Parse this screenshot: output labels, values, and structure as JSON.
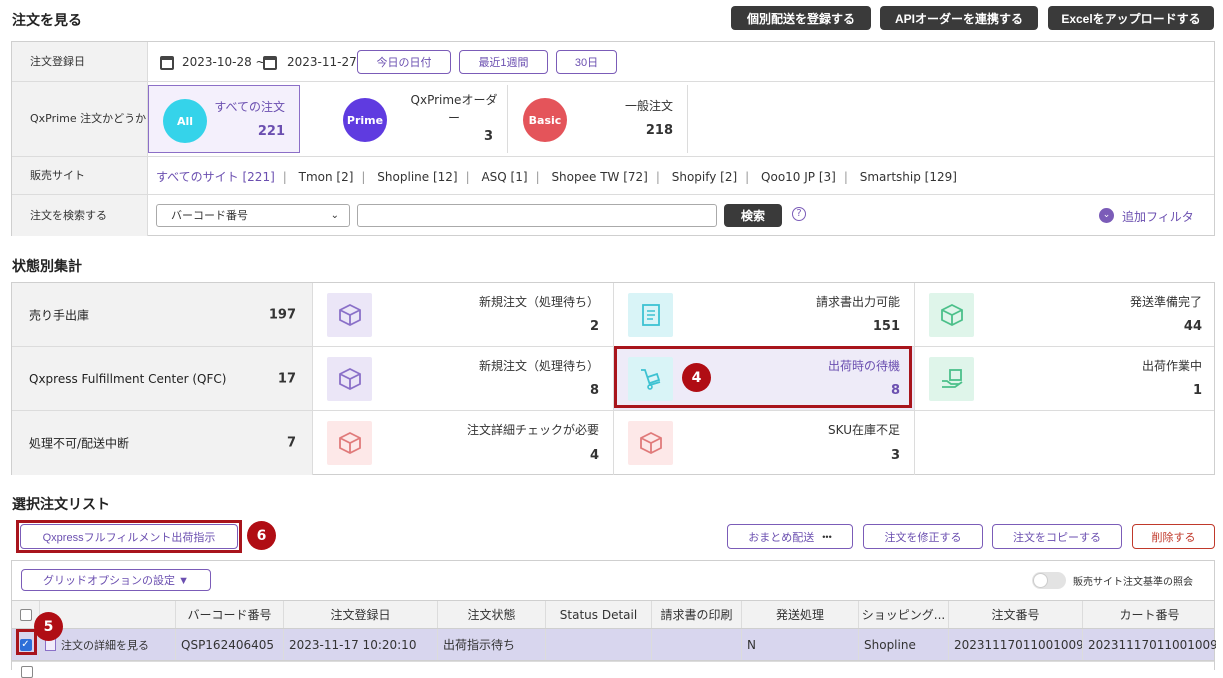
{
  "page_title": "注文を見る",
  "top_buttons": {
    "register": "個別配送を登録する",
    "api": "APIオーダーを連携する",
    "excel": "Excelをアップロードする"
  },
  "filters": {
    "date_label": "注文登録日",
    "date_from": "2023-10-28 ~",
    "date_to": "2023-11-27",
    "today_btn": "今日の日付",
    "week_btn": "最近1週間",
    "month_btn": "30日",
    "qxprime_label": "QxPrime 注文かどうか",
    "all": {
      "badge": "All",
      "label": "すべての注文",
      "count": "221"
    },
    "prime": {
      "badge": "Prime",
      "label": "QxPrimeオーダー",
      "count": "3"
    },
    "basic": {
      "badge": "Basic",
      "label": "一般注文",
      "count": "218"
    },
    "site_label": "販売サイト",
    "sites": [
      "すべてのサイト [221]",
      "Tmon [2]",
      "Shopline [12]",
      "ASQ [1]",
      "Shopee TW [72]",
      "Shopify [2]",
      "Qoo10 JP [3]",
      "Smartship [129]"
    ],
    "search_label": "注文を検索する",
    "search_select": "バーコード番号",
    "search_btn": "検索",
    "help": "?",
    "add_filter": "追加フィルタ"
  },
  "status": {
    "title": "状態別集計",
    "rows": [
      {
        "label": "売り手出庫",
        "count": "197",
        "cells": [
          {
            "label": "新規注文（処理待ち）",
            "value": "2"
          },
          {
            "label": "請求書出力可能",
            "value": "151"
          },
          {
            "label": "発送準備完了",
            "value": "44"
          }
        ]
      },
      {
        "label": "Qxpress Fulfillment Center (QFC)",
        "count": "17",
        "cells": [
          {
            "label": "新規注文（処理待ち）",
            "value": "8"
          },
          {
            "label": "出荷時の待機",
            "value": "8"
          },
          {
            "label": "出荷作業中",
            "value": "1"
          }
        ]
      },
      {
        "label": "処理不可/配送中断",
        "count": "7",
        "cells": [
          {
            "label": "注文詳細チェックが必要",
            "value": "4"
          },
          {
            "label": "SKU在庫不足",
            "value": "3"
          }
        ]
      }
    ]
  },
  "list": {
    "title": "選択注文リスト",
    "qfc_btn": "Qxpressフルフィルメント出荷指示",
    "bundle_btn": "おまとめ配送",
    "bundle_dots": "•••",
    "edit_btn": "注文を修正する",
    "copy_btn": "注文をコピーする",
    "delete_btn": "削除する",
    "grid_option": "グリッドオプションの設定 ▼",
    "toggle_label": "販売サイト注文基準の照会",
    "columns": [
      "",
      "",
      "バーコード番号",
      "注文登録日",
      "注文状態",
      "Status Detail",
      "請求書の印刷",
      "発送処理",
      "ショッピング...",
      "注文番号",
      "カート番号"
    ],
    "row": [
      "",
      "注文の詳細を見る",
      "QSP162406405",
      "2023-11-17 10:20:10",
      "出荷指示待ち",
      "",
      "",
      "N",
      "Shopline",
      "20231117011001009",
      "20231117011001009"
    ]
  },
  "markers": {
    "m4": "4",
    "m5": "5",
    "m6": "6"
  }
}
